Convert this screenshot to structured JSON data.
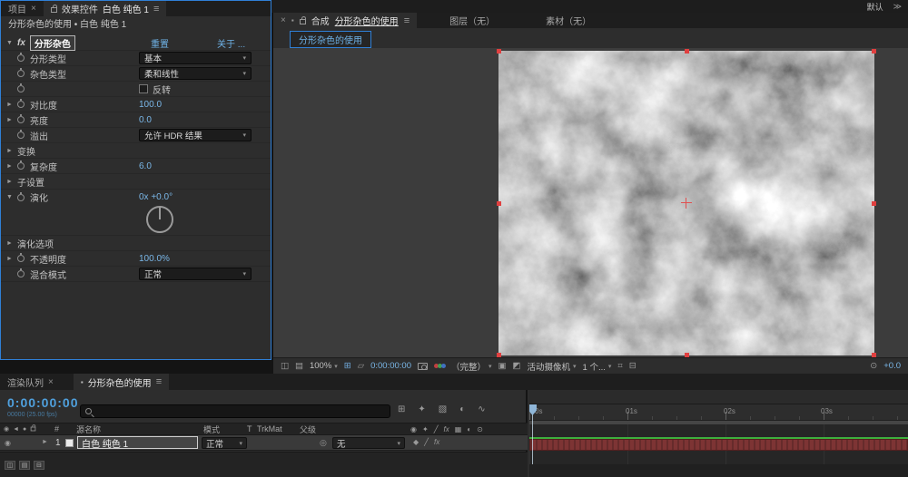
{
  "icons": {
    "home": "⌂",
    "selection": "➤",
    "hand": "✥",
    "zoom": "⊕",
    "orbit": "↻",
    "pan_behind": "✛",
    "shape": "▭",
    "pen": "✎",
    "text": "T",
    "brush": "▨",
    "puppet": "⌖",
    "axis": "◇",
    "menu": "≡",
    "close": "×",
    "caret": "▾",
    "twirl_open": "▼",
    "twirl_closed": "►",
    "overflow": "≫",
    "eye": "◉",
    "audio": "◄",
    "solo": "●",
    "pickwhip": "◎",
    "fx": "fx",
    "diamond": "◆",
    "quality": "╱",
    "comp_mini": "▪",
    "flowchart": "⊞",
    "draft3d": "✦",
    "frame_blend": "▧",
    "motion_blur": "◐",
    "graph_editor": "∿",
    "preview": "◫",
    "monitor": "▤",
    "grid": "⊞",
    "mask_vis": "▱",
    "roi": "▣",
    "transparency": "◩",
    "view_layout": "⌗",
    "pixel_aspect": "⊟",
    "exposure": "⊙",
    "switch_shy": "◉",
    "switch_collapse": "✦",
    "switch_quality": "╱",
    "switch_fx": "fx",
    "switch_blend": "▦",
    "switch_mblur": "◐",
    "switch_3d": "⊙",
    "pane_a": "◫",
    "pane_b": "▤",
    "pane_c": "⊟"
  },
  "topbar": {
    "workspace": "默认"
  },
  "ec": {
    "tab_project": "项目",
    "tab_title": "效果控件",
    "tab_target": "白色 纯色 1",
    "breadcrumb": "分形杂色的使用 • 白色 纯色 1",
    "effect_name": "分形杂色",
    "reset": "重置",
    "about": "关于 ...",
    "rows": [
      {
        "label": "分形类型",
        "value": "基本"
      },
      {
        "label": "杂色类型",
        "value": "柔和线性"
      },
      {
        "label": "反转",
        "value": ""
      },
      {
        "label": "对比度",
        "value": "100.0"
      },
      {
        "label": "亮度",
        "value": "0.0"
      },
      {
        "label": "溢出",
        "value": "允许 HDR 结果"
      },
      {
        "label": "变换",
        "value": ""
      },
      {
        "label": "复杂度",
        "value": "6.0"
      },
      {
        "label": "子设置",
        "value": ""
      },
      {
        "label": "演化",
        "value": "0x +0.0°"
      },
      {
        "label": "演化选项",
        "value": ""
      },
      {
        "label": "不透明度",
        "value": "100.0%"
      },
      {
        "label": "混合模式",
        "value": "正常"
      }
    ]
  },
  "comp": {
    "tab_title": "合成",
    "tab_target": "分形杂色的使用",
    "tab_layer": "图层（无）",
    "tab_footage": "素材（无）",
    "viewer_tab": "分形杂色的使用",
    "toolbar": {
      "zoom": "100%",
      "time": "0:00:00:00",
      "resolution": "（完整）",
      "camera": "活动摄像机",
      "views": "1 个...",
      "exposure": "+0.0"
    }
  },
  "timeline": {
    "tab_render_queue": "渲染队列",
    "tab_comp": "分形杂色的使用",
    "time": "0:00:00:00",
    "frames": "00000 (25.00 fps)",
    "search_placeholder": "",
    "columns": {
      "number": "#",
      "source": "源名称",
      "mode": "模式",
      "t": "T",
      "trkmat": "TrkMat",
      "parent": "父级"
    },
    "layer": {
      "index": "1",
      "name": "白色 纯色 1",
      "mode": "正常",
      "parent": "无"
    },
    "ruler": [
      "0s",
      "01s",
      "02s",
      "03s"
    ]
  }
}
